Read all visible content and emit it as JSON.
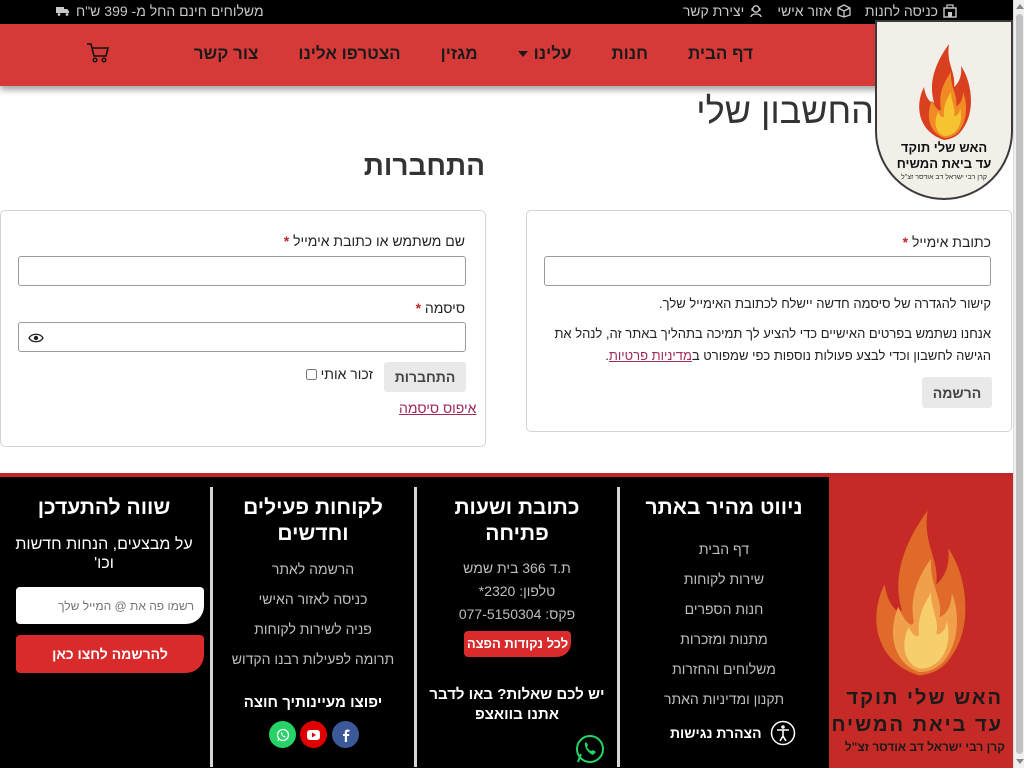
{
  "topbar": {
    "links": [
      {
        "label": "כניסה לחנות",
        "icon": "store-icon"
      },
      {
        "label": "אזור אישי",
        "icon": "box-icon"
      },
      {
        "label": "יצירת קשר",
        "icon": "support-icon"
      }
    ],
    "shipping": "משלוחים חינם החל מ- 399 ש\"ח"
  },
  "nav": {
    "items": [
      "דף הבית",
      "חנות",
      "עלינו",
      "מגזין",
      "הצטרפו אלינו",
      "צור קשר"
    ]
  },
  "logo": {
    "line1": "האש שלי תוקד",
    "line2": "עד ביאת המשיח",
    "line3": "קרן רבי ישראל דב אודסר זצ\"ל"
  },
  "page": {
    "title": "החשבון שלי",
    "login_title": "התחברות"
  },
  "login": {
    "username_label": "שם משתמש או כתובת אימייל",
    "password_label": "סיסמה",
    "required_mark": "*",
    "submit": "התחברות",
    "remember": "זכור אותי",
    "lost_password": "איפוס סיסמה"
  },
  "register": {
    "email_label": "כתובת אימייל",
    "required_mark": "*",
    "note1": "קישור להגדרה של סיסמה חדשה יישלח לכתובת האימייל שלך.",
    "note2a": "אנחנו נשתמש בפרטים האישיים כדי להציע לך תמיכה בתהליך באתר זה, לנהל את",
    "note2b": "הגישה לחשבון וכדי לבצע פעולות נוספות כפי שמפורט ב",
    "privacy_link": "מדיניות פרטיות",
    "note2c": ".",
    "submit": "הרשמה"
  },
  "footer": {
    "quick_nav": {
      "title": "ניווט מהיר באתר",
      "items": [
        "דף הבית",
        "שירות לקוחות",
        "חנות הספרים",
        "מתנות ומזכרות",
        "משלוחים והחזרות",
        "תקנון ומדיניות האתר"
      ],
      "accessibility": "הצהרת נגישות"
    },
    "address": {
      "title": "כתובת ושעות פתיחה",
      "lines": [
        "ת.ד 366 בית שמש",
        "טלפון: 2320*",
        "פקס: 077-5150304"
      ],
      "points_button": "לכל נקודות הפצה",
      "whatsapp_title": "יש לכם שאלות? באו לדבר אתנו בוואצפ"
    },
    "clients": {
      "title": "לקוחות פעילים וחדשים",
      "items": [
        "הרשמה לאתר",
        "כניסה לאזור האישי",
        "פניה לשירות לקוחות",
        "תרומה לפעילות רבנו הקדוש"
      ],
      "social_title": "יפוצו מעיינותיך חוצה"
    },
    "newsletter": {
      "title": "שווה להתעדכן",
      "subtitle": "על מבצעים, הנחות חדשות וכו'",
      "placeholder": "רשמו פה את @ המייל שלך",
      "button": "להרשמה לחצו כאן"
    },
    "logo": {
      "line1": "האש שלי תוקד",
      "line2": "עד ביאת המשיח",
      "line3": "קרן רבי ישראל דב אודסר זצ\"ל"
    }
  },
  "colors": {
    "brand_red": "#d63a38",
    "footer_bg": "#000000",
    "link": "#a0285a",
    "whatsapp": "#25d366",
    "youtube": "#e00000",
    "facebook": "#3b5998"
  }
}
